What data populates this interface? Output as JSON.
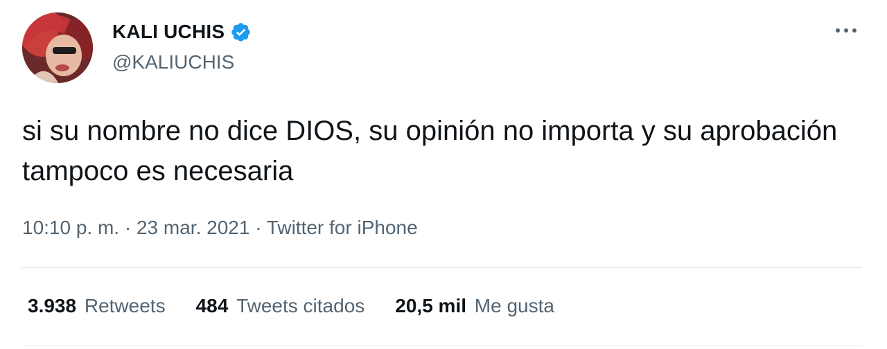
{
  "author": {
    "display_name": "KALI UCHIS",
    "handle": "@KALIUCHIS",
    "verified_icon": "verified-badge-icon",
    "avatar": "profile-photo"
  },
  "tweet": {
    "text": "si su nombre no dice DIOS, su opinión no importa y su aprobación tampoco es necesaria",
    "meta": "10:10 p. m. · 23 mar. 2021 · Twitter for iPhone"
  },
  "stats": {
    "retweets_count": "3.938",
    "retweets_label": "Retweets",
    "quotes_count": "484",
    "quotes_label": "Tweets citados",
    "likes_count": "20,5 mil",
    "likes_label": "Me gusta"
  },
  "colors": {
    "text_primary": "#0f1419",
    "text_secondary": "#536471",
    "verified_blue": "#1d9bf0",
    "divider": "#e3e7ea"
  },
  "icons": {
    "more": "more-options-icon"
  }
}
